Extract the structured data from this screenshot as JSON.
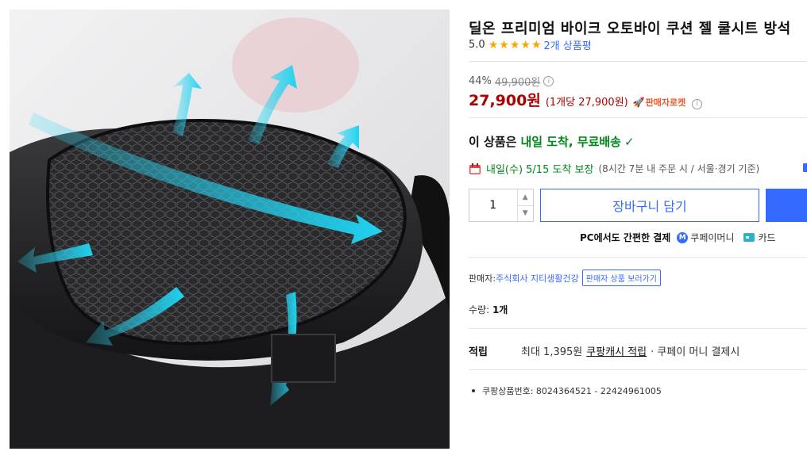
{
  "product": {
    "title": "딜온 프리미엄 바이크 오토바이 쿠션 젤 쿨시트 방석",
    "rating_score": "5.0",
    "stars": 5,
    "review_count": "2개 상품평"
  },
  "price": {
    "discount_rate": "44%",
    "original_price": "49,900원",
    "sale_price": "27,900원",
    "unit_price": "(1개당 27,900원)",
    "seller_rocket_label": "판매자로켓"
  },
  "delivery": {
    "headline_prefix": "이 상품은",
    "headline_highlight": "내일 도착, 무료배송",
    "date_text": "내일(수) 5/15 도착 보장",
    "note_text": "(8시간 7분  내 주문 시 / 서울·경기 기준)"
  },
  "purchase": {
    "quantity": "1",
    "cart_button_label": "장바구니 담기"
  },
  "payment": {
    "label": "PC에서도 간편한 결제",
    "coupay_icon_text": "M",
    "coupay_label": "쿠페이머니",
    "card_label": "카드"
  },
  "seller": {
    "label": "판매자:",
    "name": "주식회사 지티생활건강",
    "more_label": "판매자 상품 보러가기"
  },
  "quantity_summary": {
    "label": "수량:",
    "value": "1개"
  },
  "reward": {
    "label": "적립",
    "prefix": "최대 1,395원",
    "link": "쿠팡캐시 적립",
    "suffix": "· 쿠페이 머니 결제시"
  },
  "product_number": "쿠팡상품번호: 8024364521 - 22424961005",
  "icons": {
    "star": "star-icon",
    "info": "info-icon",
    "rocket": "rocket-icon",
    "check": "check-icon",
    "calendar": "calendar-icon",
    "coupay": "coupay-money-icon",
    "card": "card-icon"
  },
  "colors": {
    "accent_blue": "#346aff",
    "price_red": "#ae0000",
    "delivery_green": "#00891a",
    "star_yellow": "#f5a800",
    "rocket_orange": "#e85a2a"
  }
}
